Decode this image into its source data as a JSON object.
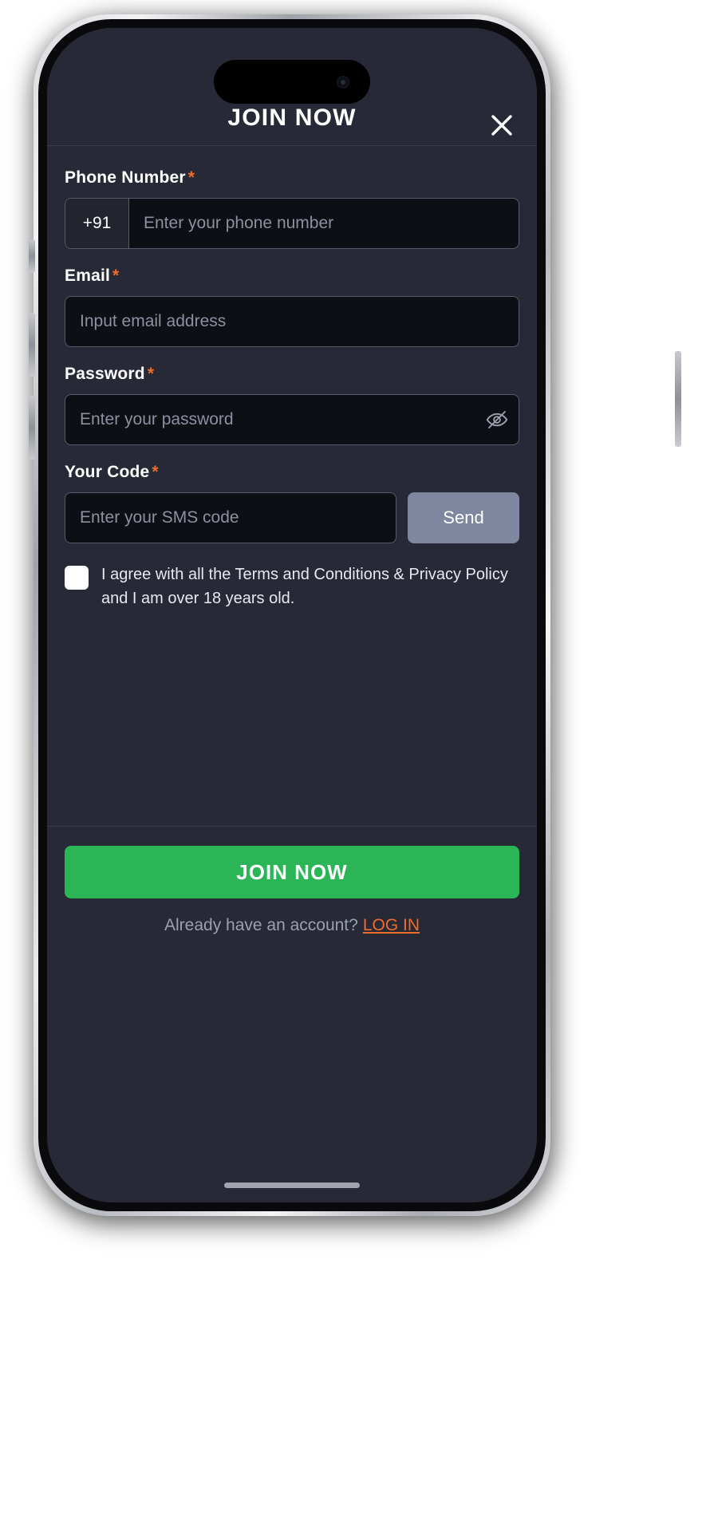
{
  "modal": {
    "title": "JOIN NOW",
    "close_icon": "close-icon"
  },
  "form": {
    "phone": {
      "label": "Phone Number",
      "required_mark": "*",
      "country_code": "+91",
      "placeholder": "Enter your phone number",
      "value": ""
    },
    "email": {
      "label": "Email",
      "required_mark": "*",
      "placeholder": "Input email address",
      "value": ""
    },
    "password": {
      "label": "Password",
      "required_mark": "*",
      "placeholder": "Enter your password",
      "value": "",
      "toggle_icon": "eye-off-icon"
    },
    "code": {
      "label": "Your Code",
      "required_mark": "*",
      "placeholder": "Enter your SMS code",
      "value": "",
      "send_label": "Send"
    },
    "agreement": {
      "text": "I agree with all the Terms and Conditions & Privacy Policy and I am over 18 years old.",
      "checked": false
    }
  },
  "footer": {
    "submit_label": "JOIN NOW",
    "login_prompt": "Already have an account?",
    "login_link": "LOG IN"
  },
  "colors": {
    "accent_orange": "#ef6c2a",
    "submit_green": "#2bb556",
    "send_gray": "#7e879f",
    "screen_bg": "#272a36",
    "input_bg": "#0d0f14"
  }
}
